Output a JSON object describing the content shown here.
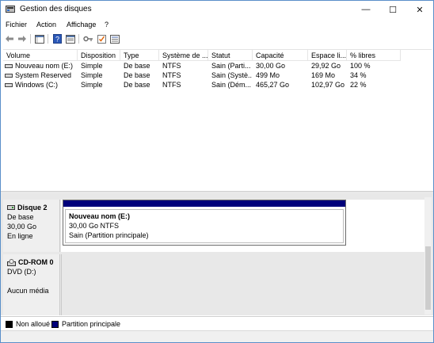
{
  "window": {
    "title": "Gestion des disques",
    "controls": {
      "minimize": "—",
      "maximize": "☐",
      "close": "✕"
    }
  },
  "menu": [
    "Fichier",
    "Action",
    "Affichage",
    "?"
  ],
  "toolbar": {
    "icons": [
      "back-arrow-icon",
      "forward-arrow-icon",
      "console-tree-icon",
      "help-icon",
      "properties-icon",
      "key-icon",
      "checklist-icon",
      "list-view-icon"
    ]
  },
  "volumes": {
    "headers": [
      "Volume",
      "Disposition",
      "Type",
      "Système de ...",
      "Statut",
      "Capacité",
      "Espace li...",
      "% libres"
    ],
    "rows": [
      [
        "Nouveau nom (E:)",
        "Simple",
        "De base",
        "NTFS",
        "Sain (Parti...",
        "30,00 Go",
        "29,92 Go",
        "100 %"
      ],
      [
        "System Reserved",
        "Simple",
        "De base",
        "NTFS",
        "Sain (Systè...",
        "499 Mo",
        "169 Mo",
        "34 %"
      ],
      [
        "Windows (C:)",
        "Simple",
        "De base",
        "NTFS",
        "Sain (Dém...",
        "465,27 Go",
        "102,97 Go",
        "22 %"
      ]
    ]
  },
  "disks": [
    {
      "name": "Disque 2",
      "lines": [
        "De base",
        "30,00 Go",
        "En ligne"
      ],
      "partition": {
        "name": "Nouveau nom  (E:)",
        "size": "30,00 Go NTFS",
        "status": "Sain (Partition principale)",
        "color": "#00007a"
      }
    },
    {
      "name": "CD-ROM 0",
      "lines": [
        "DVD (D:)",
        "",
        "Aucun média"
      ]
    }
  ],
  "legend": [
    {
      "label": "Non alloué",
      "color": "#000000"
    },
    {
      "label": "Partition principale",
      "color": "#00007a"
    }
  ]
}
